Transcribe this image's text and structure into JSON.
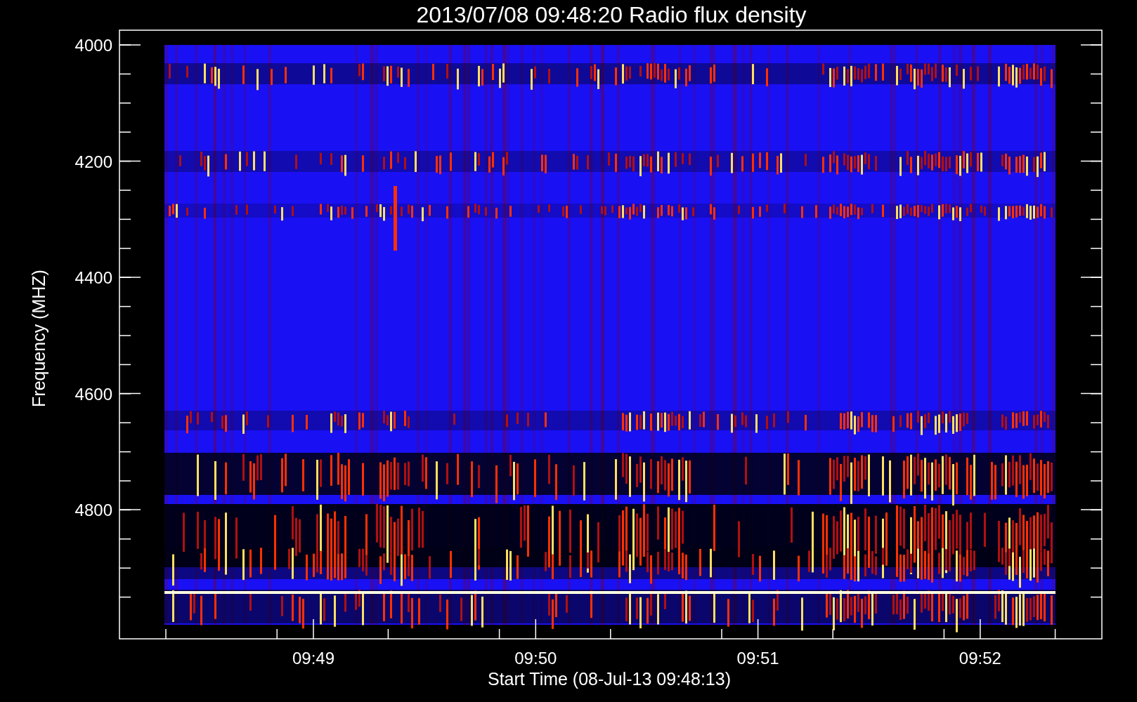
{
  "title": "2013/07/08 09:48:20 Radio flux density",
  "y_axis": {
    "label": "Frequency (MHZ)",
    "ticks": [
      "4000",
      "4200",
      "4400",
      "4600",
      "4800"
    ]
  },
  "x_axis": {
    "label": "Start Time (08-Jul-13 09:48:13)",
    "ticks": [
      "09:49",
      "09:50",
      "09:51",
      "09:52"
    ]
  }
}
